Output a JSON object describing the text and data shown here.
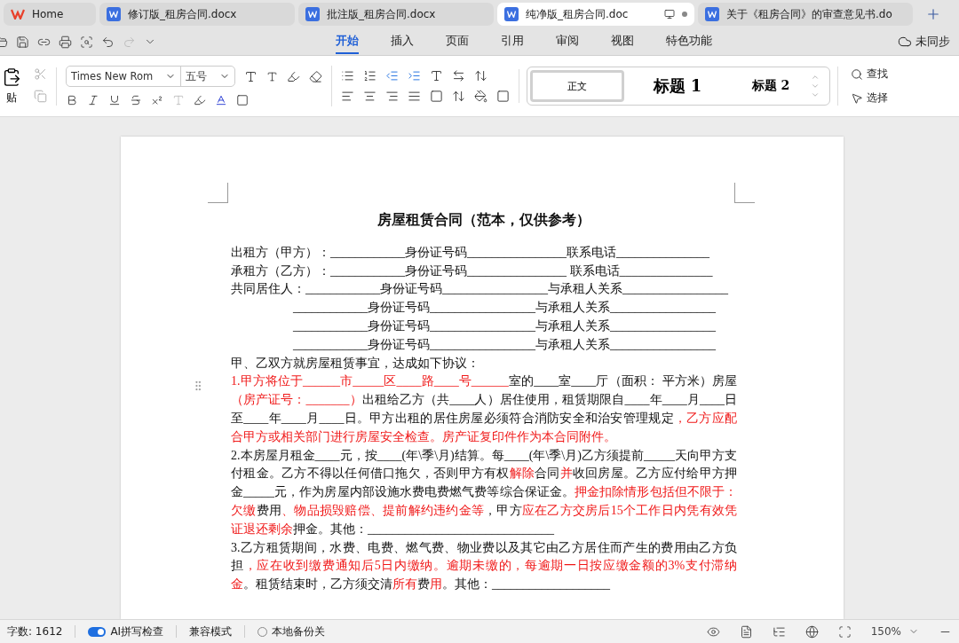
{
  "tabs": [
    {
      "label": "Home",
      "kind": "home",
      "selected": false
    },
    {
      "label": "修订版_租房合同.docx",
      "kind": "doc",
      "selected": false
    },
    {
      "label": "批注版_租房合同.docx",
      "kind": "doc",
      "selected": false
    },
    {
      "label": "纯净版_租房合同.doc",
      "kind": "doc",
      "selected": true
    },
    {
      "label": "关于《租房合同》的审查意见书.do",
      "kind": "doc",
      "selected": false
    }
  ],
  "menu": [
    {
      "label": "开始",
      "selected": true
    },
    {
      "label": "插入",
      "selected": false
    },
    {
      "label": "页面",
      "selected": false
    },
    {
      "label": "引用",
      "selected": false
    },
    {
      "label": "审阅",
      "selected": false
    },
    {
      "label": "视图",
      "selected": false
    },
    {
      "label": "特色功能",
      "selected": false
    }
  ],
  "sync_status": "未同步",
  "ribbon": {
    "paste": "贴",
    "font": "Times New Rom",
    "font_size": "五号",
    "styles": [
      {
        "label": "正文",
        "kind": "body",
        "selected": true
      },
      {
        "label": "标题 1",
        "kind": "h1",
        "selected": false
      },
      {
        "label": "标题 2",
        "kind": "h2",
        "selected": false
      }
    ],
    "find": "查找",
    "select": "选择"
  },
  "document": {
    "title": "房屋租赁合同（范本，仅供参考）",
    "party_lines": [
      {
        "text": "出租方（甲方）：____________身份证号码________________联系电话_______________",
        "indented": false
      },
      {
        "text": "承租方（乙方）：____________身份证号码________________ 联系电话_______________",
        "indented": false
      },
      {
        "text": "共同居住人：____________身份证号码_________________与承租人关系_________________",
        "indented": false
      },
      {
        "text": "____________身份证号码_________________与承租人关系_________________",
        "indented": true
      },
      {
        "text": "____________身份证号码_________________与承租人关系_________________",
        "indented": true
      },
      {
        "text": "____________身份证号码_________________与承租人关系_________________",
        "indented": true
      }
    ],
    "intro": "甲、乙双方就房屋租赁事宜，达成如下协议：",
    "clauses": [
      [
        {
          "text": "1.甲方将位于______市_____区____路____号______",
          "red": true
        },
        {
          "text": "室的____室____厅（面积：      平方米）房屋",
          "red": false
        },
        {
          "text": "（房产证号：_______）",
          "red": true
        },
        {
          "text": "出租给乙方（共____人）居住使用，租赁期限自____年____月____日至____年____月____日。甲方出租的居住房屋必须符合消防安全和治安管理规定",
          "red": false
        },
        {
          "text": "，乙方应配合甲方或相关部门进行房屋安全检查。房产证复印件作为本合同附件。",
          "red": true
        }
      ],
      [
        {
          "text": "2.本房屋月租金____元，按____(年\\季\\月)结算。每____(年\\季\\月)乙方须提前_____天向甲方支付租金。乙方不得以任何借口拖欠，否则甲方有权",
          "red": false
        },
        {
          "text": "解除",
          "red": true
        },
        {
          "text": "合同",
          "red": false
        },
        {
          "text": "并",
          "red": true
        },
        {
          "text": "收回房屋。乙方应付给甲方押金_____元，作为房屋内部设施水费电费燃气费等综合保证金。",
          "red": false
        },
        {
          "text": "押金扣除情形包括但不限于：欠缴",
          "red": true
        },
        {
          "text": "费用",
          "red": false
        },
        {
          "text": "、物品损毁赔偿、提前解约违约金等",
          "red": true
        },
        {
          "text": "，甲方",
          "red": false
        },
        {
          "text": "应在乙方交房后15个工作日内凭有效凭证退还剩余",
          "red": true
        },
        {
          "text": "押金。其他：______________________________",
          "red": false
        }
      ],
      [
        {
          "text": "3.乙方租赁期间，水费、电费、燃气费、物业费以及其它由乙方居住而产生的费用由乙方负担",
          "red": false
        },
        {
          "text": "，应在收到缴费通知后5日内缴纳。逾期未缴的，每逾期一日按应缴金额的3%支付滞纳金",
          "red": true
        },
        {
          "text": "。租赁结束时，乙方须交清",
          "red": false
        },
        {
          "text": "所有",
          "red": true
        },
        {
          "text": "费",
          "red": false
        },
        {
          "text": "用",
          "red": true
        },
        {
          "text": "。其他：___________________",
          "red": false
        }
      ]
    ]
  },
  "status_bar": {
    "word_count": "字数: 1612",
    "spell_check": {
      "label": "AI拼写检查",
      "on": true
    },
    "compat_mode": "兼容模式",
    "backup": "本地备份关",
    "zoom": "150%"
  }
}
